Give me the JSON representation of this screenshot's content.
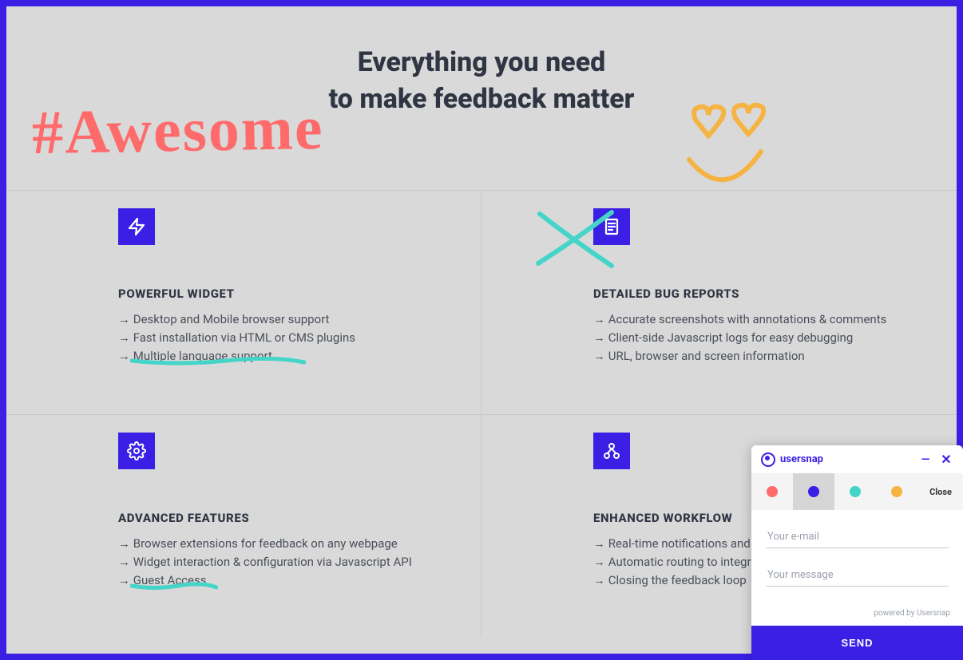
{
  "hero": {
    "title_line1": "Everything you need",
    "title_line2": "to make feedback matter"
  },
  "features": [
    {
      "icon": "lightning-icon",
      "title": "POWERFUL WIDGET",
      "items": [
        "Desktop and Mobile browser support",
        "Fast installation via HTML or CMS plugins",
        "Multiple language support"
      ]
    },
    {
      "icon": "document-icon",
      "title": "DETAILED BUG REPORTS",
      "items": [
        "Accurate screenshots with annotations & comments",
        "Client-side Javascript logs for easy debugging",
        "URL, browser and screen information"
      ]
    },
    {
      "icon": "gear-icon",
      "title": "ADVANCED FEATURES",
      "items": [
        "Browser extensions for feedback on any webpage",
        "Widget interaction & configuration via Javascript API",
        "Guest Access"
      ]
    },
    {
      "icon": "share-icon",
      "title": "ENHANCED WORKFLOW",
      "items": [
        "Real-time notifications and updates",
        "Automatic routing to integrations",
        "Closing the feedback loop"
      ]
    }
  ],
  "annotations": {
    "handwritten_text": "#Awesome",
    "smiley": "heart-eyes-smiley",
    "crossed_out_feature_index": 1,
    "underlined_items": [
      {
        "feature_index": 0,
        "item_index": 2
      },
      {
        "feature_index": 2,
        "item_index": 2
      }
    ],
    "pen_colors": {
      "red": "#ff6b6b",
      "teal": "#45d5c8",
      "orange": "#f5b342"
    }
  },
  "widget": {
    "brand": "usersnap",
    "colors": [
      {
        "hex": "#ff6b6b",
        "active": false
      },
      {
        "hex": "#3b1fe5",
        "active": true
      },
      {
        "hex": "#45d5c8",
        "active": false
      },
      {
        "hex": "#f5b342",
        "active": false
      }
    ],
    "close_label": "Close",
    "email_placeholder": "Your e-mail",
    "message_placeholder": "Your message",
    "powered_by": "powered by Usersnap",
    "send_label": "SEND"
  }
}
